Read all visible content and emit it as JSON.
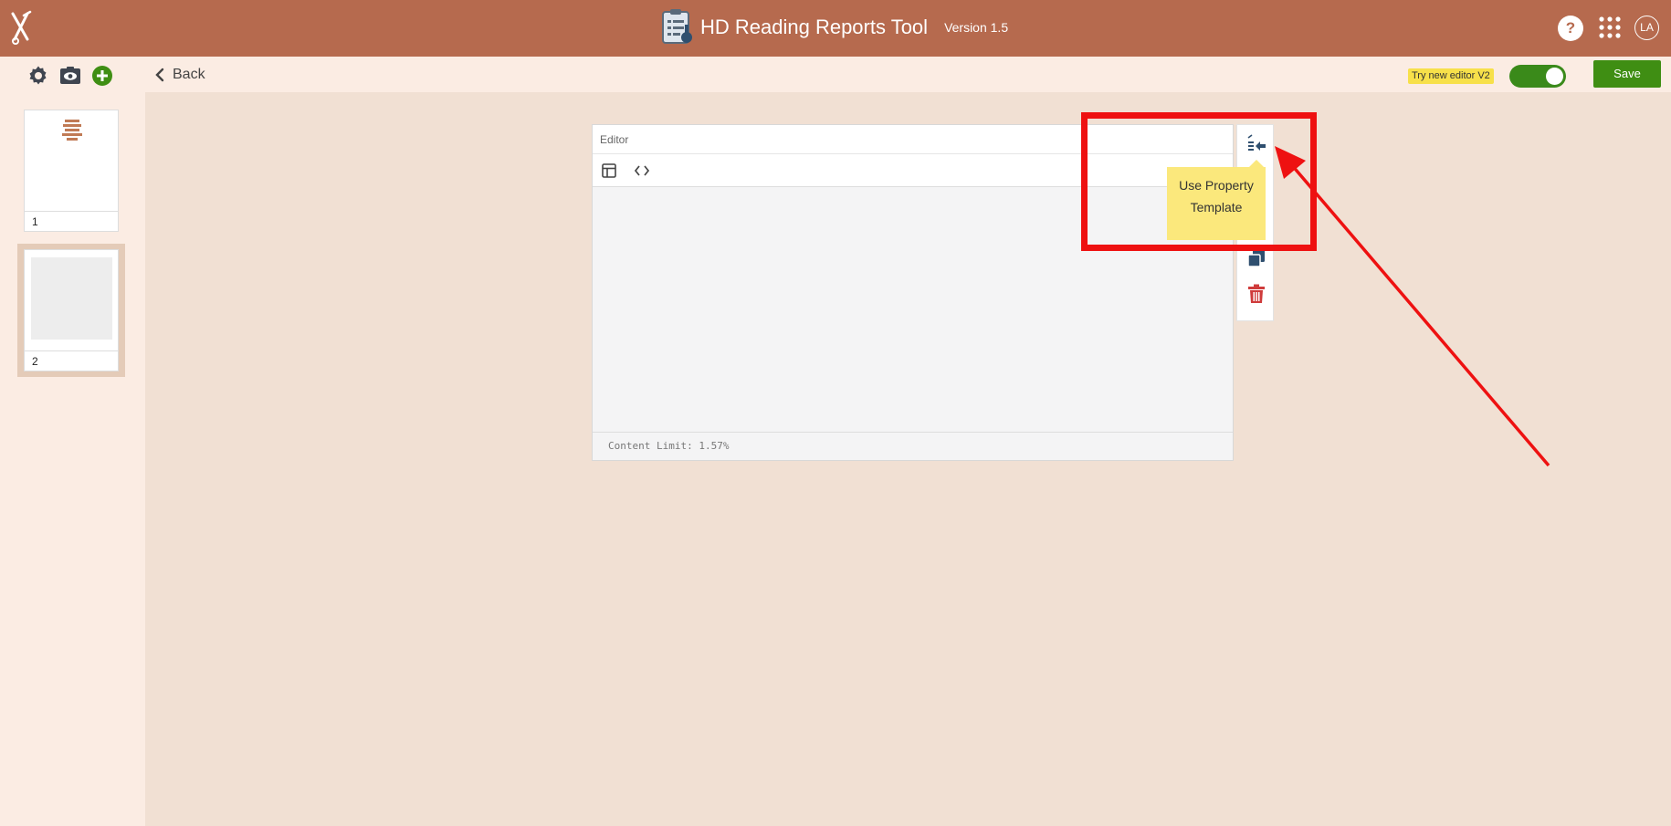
{
  "header": {
    "title": "HD Reading Reports Tool",
    "version": "Version 1.5",
    "help_label": "?",
    "avatar_initials": "LA"
  },
  "toolbar": {
    "back_label": "Back",
    "try_new_editor_label": "Try new editor V2",
    "toggle_on": true,
    "save_label": "Save"
  },
  "pages": [
    {
      "number": "1"
    },
    {
      "number": "2"
    }
  ],
  "editor": {
    "title": "Editor",
    "content_limit": "Content Limit: 1.57%"
  },
  "tooltip": {
    "line1": "Use Property",
    "line2": "Template"
  },
  "colors": {
    "header_bg": "#b66a4e",
    "subbar_bg": "#fbece3",
    "canvas_bg": "#f1e0d3",
    "save_green": "#3f8e13",
    "highlight_red": "#ee1111",
    "tooltip_yellow": "#fbe87c"
  },
  "icons": [
    "logo-icon",
    "report-icon",
    "help-icon",
    "apps-grid-icon",
    "gear-icon",
    "eye-icon",
    "add-icon",
    "chevron-left-icon",
    "layout-icon",
    "code-icon",
    "use-template-icon",
    "duplicate-icon",
    "trash-icon"
  ]
}
